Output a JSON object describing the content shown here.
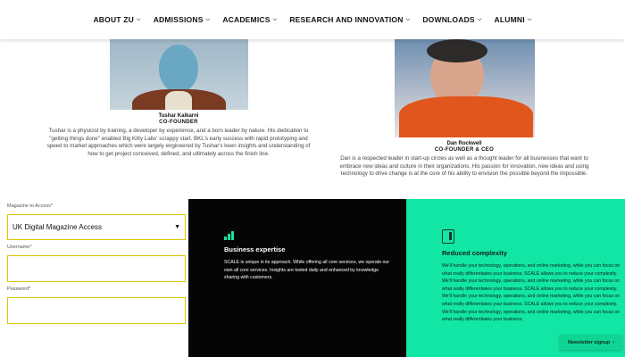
{
  "nav": {
    "items": [
      {
        "label": "ABOUT ZU"
      },
      {
        "label": "ADMISSIONS"
      },
      {
        "label": "ACADEMICS"
      },
      {
        "label": "RESEARCH AND INNOVATION"
      },
      {
        "label": "DOWNLOADS"
      },
      {
        "label": "ALUMNI"
      }
    ]
  },
  "team": [
    {
      "name": "Tushar Kalkarni",
      "role": "CO-FOUNDER",
      "bio": "Tushar is a physicist by training, a developer by experience, and a born leader by nature. His dedication to \"getting things done\" enabled Big Kitty Labs' scrappy start. BKL's early success with rapid prototyping and speed to market approaches which were largely engineered by Tushar's keen insights and understanding of how to get project conceived, defined, and ultimately across the finish line."
    },
    {
      "name": "Dan Rockwell",
      "role": "CO-FOUNDER & CEO",
      "bio": "Dan is a respected leader in start-up circles as well as a thought leader for all businesses that want to embrace new ideas and culture in their organizations. His passion for innovation, new ideas and using technology to drive change is at the core of his ability to envision the possible beyond the impossible."
    }
  ],
  "form": {
    "magazine_label": "Magazine to Access*",
    "magazine_value": "UK Digital Magazine Access",
    "username_label": "Username*",
    "password_label": "Password*"
  },
  "business": {
    "title": "Business expertise",
    "text": "SCALE is unique in its approach. While offering all core services, we operate our own all core services. Insights are tested daily and enhanced by knowledge sharing with customers."
  },
  "complexity": {
    "title": "Reduced complexity",
    "text": "We'll handle your technology, operations, and online marketing, while you can focus on what really differentiates your business. SCALE allows you to reduce your complexity. We'll handle your technology, operations, and online marketing, while you can focus on what really differentiates your business. SCALE allows you to reduce your complexity. We'll handle your technology, operations, and online marketing, while you can focus on what really differentiates your business. SCALE allows you to reduce your complexity. We'll handle your technology, operations, and online marketing, while you can focus on what really differentiates your business."
  },
  "newsletter": {
    "label": "Newsletter signup",
    "arrow": "›"
  },
  "colors": {
    "accent": "#12e6a4",
    "dark": "#050505",
    "field_border": "#d9c700"
  }
}
